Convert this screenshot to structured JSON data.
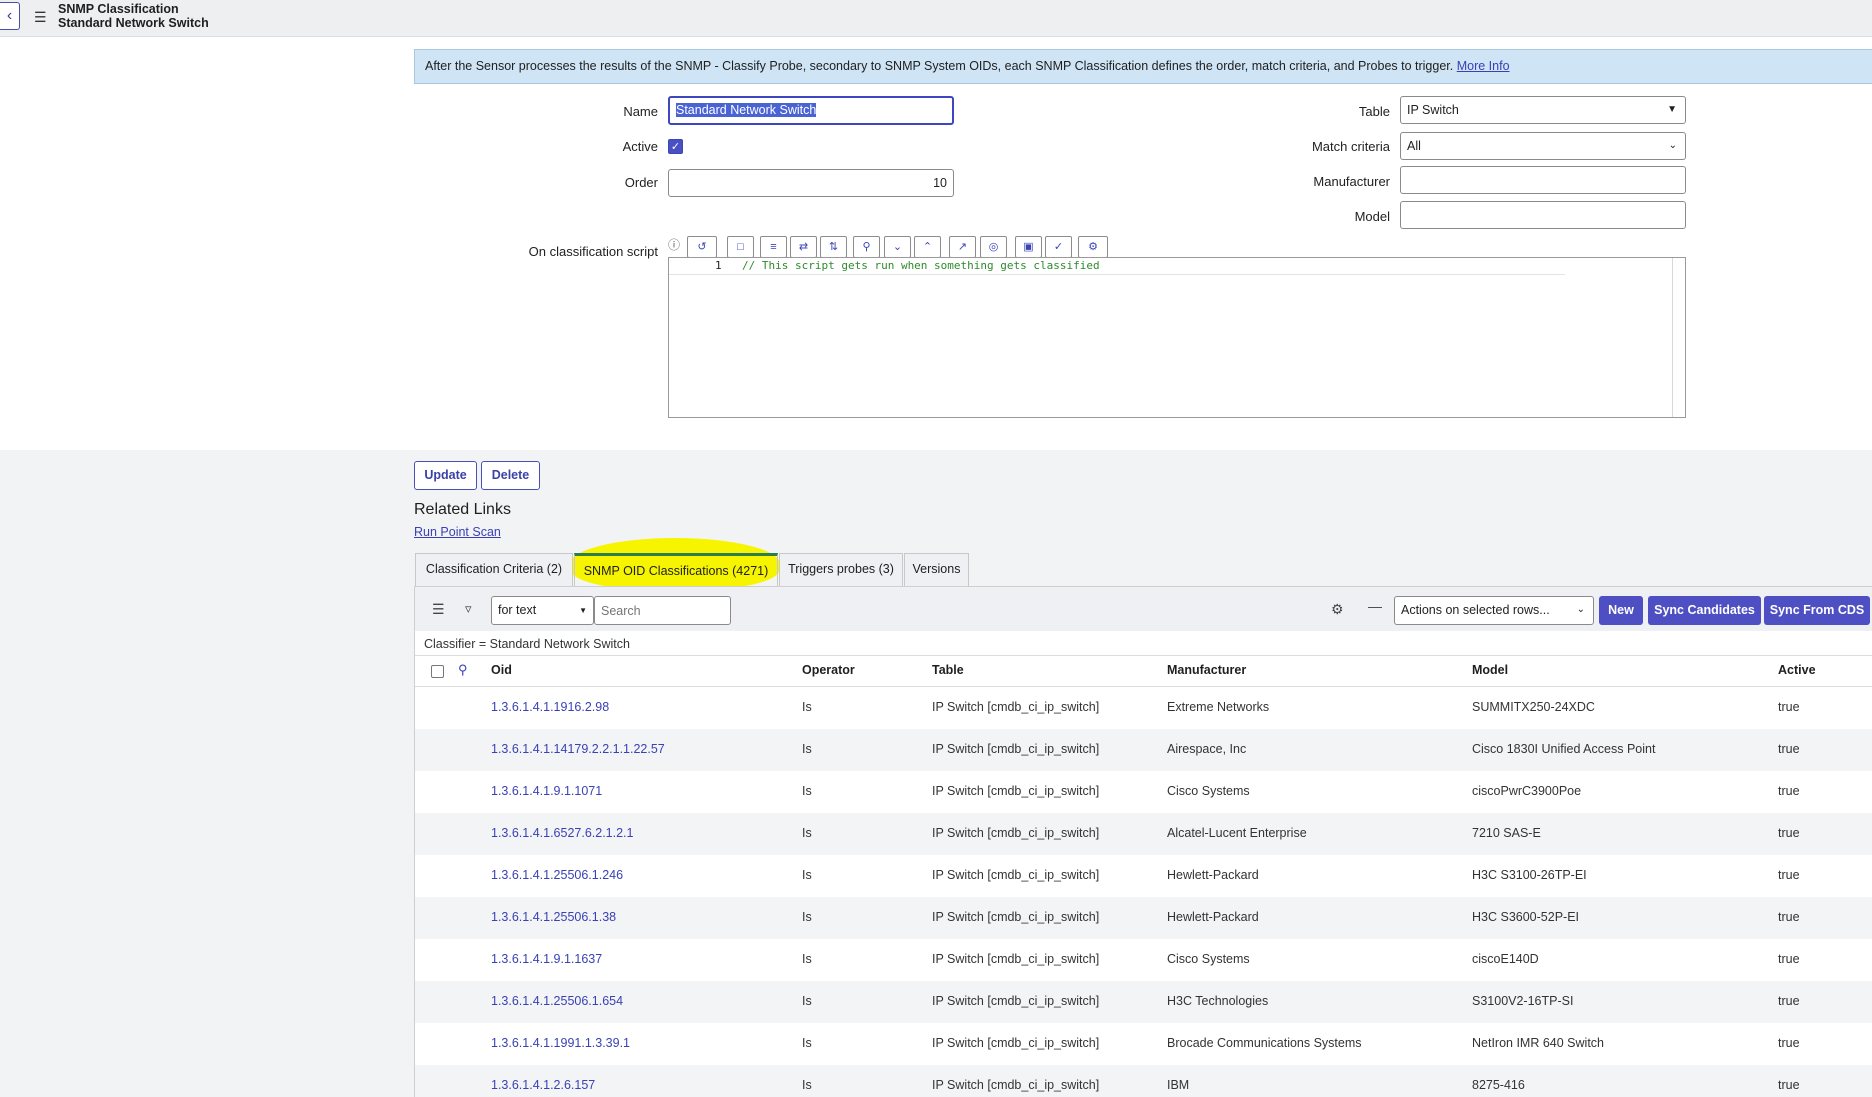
{
  "header": {
    "back_icon": "chevron-left-icon",
    "menu_icon": "hamburger-icon",
    "title": "SNMP Classification",
    "subtitle": "Standard Network Switch"
  },
  "info": {
    "text": "After the Sensor processes the results of the SNMP - Classify Probe, secondary to SNMP System OIDs, each SNMP Classification defines the order, match criteria, and Probes to trigger.",
    "link": "More Info"
  },
  "form": {
    "name_label": "Name",
    "name_value": "Standard Network Switch",
    "active_label": "Active",
    "active_checked": true,
    "order_label": "Order",
    "order_value": "10",
    "table_label": "Table",
    "table_value": "IP Switch",
    "match_label": "Match criteria",
    "match_value": "All",
    "manufacturer_label": "Manufacturer",
    "manufacturer_value": "",
    "model_label": "Model",
    "model_value": "",
    "script_label": "On classification script",
    "script_line_number": "1",
    "script_code": "// This script gets run when something gets classified"
  },
  "toolbar_icons": [
    "help-icon",
    "toggle-syntax-icon",
    "comment-icon",
    "format-icon",
    "replace-icon",
    "replace-all-icon",
    "search-icon",
    "next-icon",
    "previous-icon",
    "fullscreen-icon",
    "script-debugger-icon",
    "save-icon",
    "check-syntax-icon",
    "script-includes-icon"
  ],
  "buttons": {
    "update": "Update",
    "delete": "Delete"
  },
  "related": {
    "title": "Related Links",
    "link": "Run Point Scan"
  },
  "tabs": [
    {
      "label": "Classification Criteria (2)"
    },
    {
      "label": "SNMP OID Classifications (4271)"
    },
    {
      "label": "Triggers probes (3)"
    },
    {
      "label": "Versions"
    }
  ],
  "list": {
    "search_scope": "for text",
    "search_placeholder": "Search",
    "actions_select": "Actions on selected rows...",
    "new_label": "New",
    "sync_candidates_label": "Sync Candidates",
    "sync_cds_label": "Sync From CDS",
    "breadcrumb": "Classifier = Standard Network Switch",
    "columns": [
      "Oid",
      "Operator",
      "Table",
      "Manufacturer",
      "Model",
      "Active"
    ],
    "rows": [
      {
        "oid": "1.3.6.1.4.1.1916.2.98",
        "operator": "Is",
        "table": "IP Switch [cmdb_ci_ip_switch]",
        "manufacturer": "Extreme Networks",
        "model": "SUMMITX250-24XDC",
        "active": "true"
      },
      {
        "oid": "1.3.6.1.4.1.14179.2.2.1.1.22.57",
        "operator": "Is",
        "table": "IP Switch [cmdb_ci_ip_switch]",
        "manufacturer": "Airespace, Inc",
        "model": "Cisco 1830I Unified Access Point",
        "active": "true"
      },
      {
        "oid": "1.3.6.1.4.1.9.1.1071",
        "operator": "Is",
        "table": "IP Switch [cmdb_ci_ip_switch]",
        "manufacturer": "Cisco Systems",
        "model": "ciscoPwrC3900Poe",
        "active": "true"
      },
      {
        "oid": "1.3.6.1.4.1.6527.6.2.1.2.1",
        "operator": "Is",
        "table": "IP Switch [cmdb_ci_ip_switch]",
        "manufacturer": "Alcatel-Lucent Enterprise",
        "model": "7210 SAS-E",
        "active": "true"
      },
      {
        "oid": "1.3.6.1.4.1.25506.1.246",
        "operator": "Is",
        "table": "IP Switch [cmdb_ci_ip_switch]",
        "manufacturer": "Hewlett-Packard",
        "model": "H3C S3100-26TP-EI",
        "active": "true"
      },
      {
        "oid": "1.3.6.1.4.1.25506.1.38",
        "operator": "Is",
        "table": "IP Switch [cmdb_ci_ip_switch]",
        "manufacturer": "Hewlett-Packard",
        "model": "H3C S3600-52P-EI",
        "active": "true"
      },
      {
        "oid": "1.3.6.1.4.1.9.1.1637",
        "operator": "Is",
        "table": "IP Switch [cmdb_ci_ip_switch]",
        "manufacturer": "Cisco Systems",
        "model": "ciscoE140D",
        "active": "true"
      },
      {
        "oid": "1.3.6.1.4.1.25506.1.654",
        "operator": "Is",
        "table": "IP Switch [cmdb_ci_ip_switch]",
        "manufacturer": "H3C Technologies",
        "model": "S3100V2-16TP-SI",
        "active": "true"
      },
      {
        "oid": "1.3.6.1.4.1.1991.1.3.39.1",
        "operator": "Is",
        "table": "IP Switch [cmdb_ci_ip_switch]",
        "manufacturer": "Brocade Communications Systems",
        "model": "NetIron IMR 640 Switch",
        "active": "true"
      },
      {
        "oid": "1.3.6.1.4.1.2.6.157",
        "operator": "Is",
        "table": "IP Switch [cmdb_ci_ip_switch]",
        "manufacturer": "IBM",
        "model": "8275-416",
        "active": "true"
      }
    ]
  },
  "colors": {
    "accent": "#4d4fc3",
    "link": "#3a41b5",
    "highlight": "#f7f400",
    "banner": "#cfe4f4"
  }
}
